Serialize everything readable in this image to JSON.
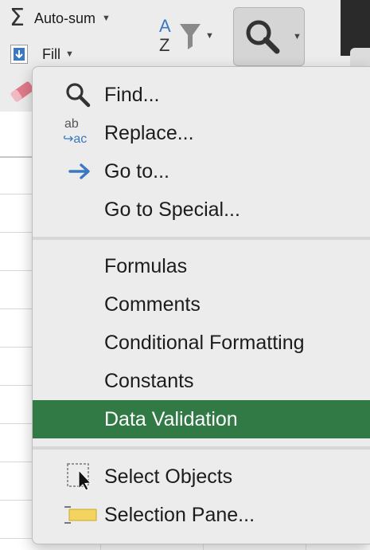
{
  "ribbon": {
    "autosum_label": "Auto-sum",
    "fill_label": "Fill",
    "sort_filter_letters": {
      "top": "A",
      "bottom": "Z"
    }
  },
  "menu": {
    "items_group1": [
      {
        "label": "Find...",
        "icon": "magnifier-icon"
      },
      {
        "label": "Replace...",
        "icon": "replace-icon",
        "icon_text_top": "ab",
        "icon_text_bottom": "↪ac"
      },
      {
        "label": "Go to...",
        "icon": "arrow-right-icon"
      },
      {
        "label": "Go to Special...",
        "icon": ""
      }
    ],
    "items_group2": [
      {
        "label": "Formulas"
      },
      {
        "label": "Comments"
      },
      {
        "label": "Conditional Formatting"
      },
      {
        "label": "Constants"
      },
      {
        "label": "Data Validation",
        "selected": true
      }
    ],
    "items_group3": [
      {
        "label": "Select Objects",
        "icon": "select-objects-icon"
      },
      {
        "label": "Selection Pane...",
        "icon": "selection-pane-icon"
      }
    ]
  },
  "colors": {
    "selected_bg": "#317a45",
    "menu_bg": "#ececec",
    "accent_blue": "#3a78c4"
  }
}
